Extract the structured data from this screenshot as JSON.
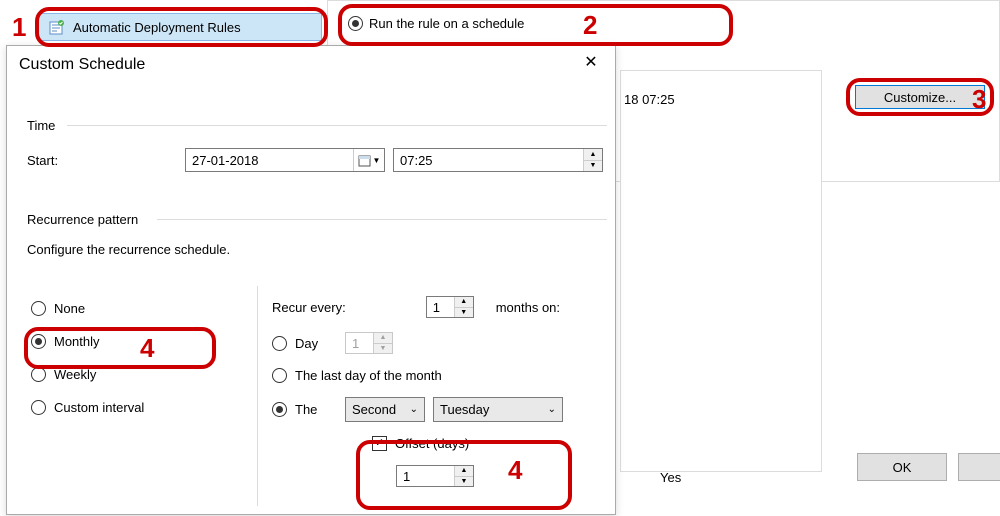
{
  "sidebar": {
    "selected_label": "Automatic Deployment Rules"
  },
  "radio_option_label": "Run the rule on a schedule",
  "schedule_preview": "18 07:25",
  "customize_label": "Customize...",
  "ok_label": "OK",
  "yes_text": "Yes",
  "modal": {
    "title": "Custom Schedule",
    "time_section": "Time",
    "start_label": "Start:",
    "date_value": "27-01-2018",
    "time_value": "07:25",
    "recurrence_section": "Recurrence pattern",
    "recurrence_hint": "Configure the recurrence schedule.",
    "options": {
      "none": "None",
      "monthly": "Monthly",
      "weekly": "Weekly",
      "custom": "Custom interval"
    },
    "recur_every_label": "Recur every:",
    "recur_every_value": "1",
    "months_on_label": "months on:",
    "day_label": "Day",
    "day_value": "1",
    "last_day_label": "The last day of the month",
    "the_label": "The",
    "ordinal_value": "Second",
    "weekday_value": "Tuesday",
    "offset_label": "Offset (days)",
    "offset_value": "1"
  },
  "annotations": {
    "n1": "1",
    "n2": "2",
    "n3": "3",
    "n4": "4"
  }
}
